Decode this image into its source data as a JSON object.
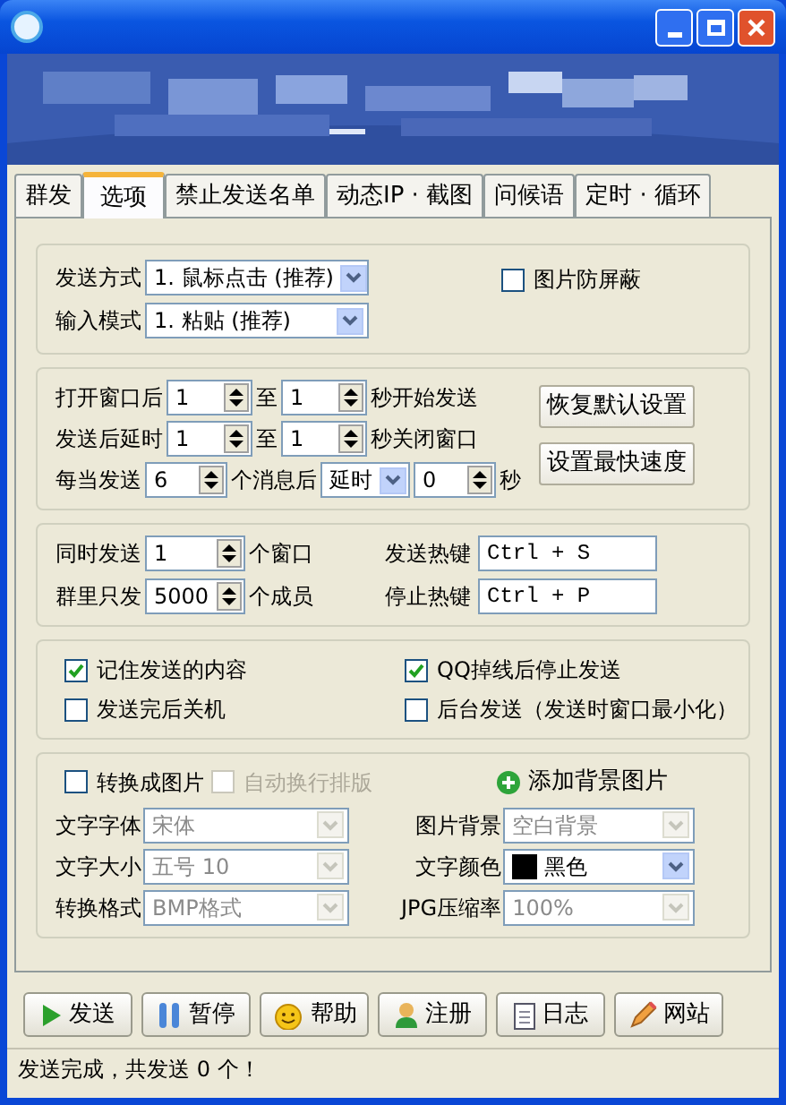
{
  "tabs": [
    {
      "label": "群发",
      "selected": false
    },
    {
      "label": "选项",
      "selected": true
    },
    {
      "label": "禁止发送名单",
      "selected": false
    },
    {
      "label": "动态IP · 截图",
      "selected": false
    },
    {
      "label": "问候语",
      "selected": false
    },
    {
      "label": "定时 · 循环",
      "selected": false
    }
  ],
  "mode_group": {
    "selects": [
      {
        "label": "发送方式",
        "value": "1. 鼠标点击 (推荐)"
      },
      {
        "label": "输入模式",
        "value": "1. 粘贴 (推荐)"
      }
    ],
    "checkbox": {
      "label": "图片防屏蔽",
      "checked": false
    }
  },
  "timing_group": {
    "rows": [
      {
        "label": "打开窗口后",
        "from": "1",
        "sep": "至",
        "to": "1",
        "suffix": "秒开始发送"
      },
      {
        "label": "发送后延时",
        "from": "1",
        "sep": "至",
        "to": "1",
        "suffix": "秒关闭窗口"
      }
    ],
    "batch": {
      "label": "每当发送",
      "count": "6",
      "middle": "个消息后",
      "action": "延时",
      "seconds": "0",
      "suffix": "秒"
    },
    "buttons": [
      "恢复默认设置",
      "设置最快速度"
    ]
  },
  "limit_group": {
    "rows": [
      {
        "label": "同时发送",
        "value": "1",
        "suffix": "个窗口"
      },
      {
        "label": "群里只发",
        "value": "5000",
        "suffix": "个成员"
      }
    ],
    "hotkeys": [
      {
        "label": "发送热键",
        "value": "Ctrl + S"
      },
      {
        "label": "停止热键",
        "value": "Ctrl + P"
      }
    ]
  },
  "options": [
    {
      "label": "记住发送的内容",
      "checked": true
    },
    {
      "label": "QQ掉线后停止发送",
      "checked": true
    },
    {
      "label": "发送完后关机",
      "checked": false
    },
    {
      "label": "后台发送（发送时窗口最小化）",
      "checked": false
    }
  ],
  "image_group": {
    "convert": {
      "label": "转换成图片",
      "checked": false
    },
    "auto_wrap": {
      "label": "自动换行排版",
      "checked": false,
      "disabled": true
    },
    "add_background": "添加背景图片",
    "selects": [
      {
        "label": "文字字体",
        "value": "宋体",
        "disabled": true
      },
      {
        "label": "图片背景",
        "value": "空白背景",
        "disabled": true
      },
      {
        "label": "文字大小",
        "value": "五号 10",
        "disabled": true
      },
      {
        "label": "文字颜色",
        "value": "黑色",
        "disabled": false,
        "color": "#000000"
      },
      {
        "label": "转换格式",
        "value": "BMP格式",
        "disabled": true
      },
      {
        "label": "JPG压缩率",
        "value": "100%",
        "disabled": true
      }
    ]
  },
  "actions": [
    {
      "label": "发送",
      "kind": "play"
    },
    {
      "label": "暂停",
      "kind": "pause"
    },
    {
      "label": "帮助",
      "kind": "smiley"
    },
    {
      "label": "注册",
      "kind": "user"
    },
    {
      "label": "日志",
      "kind": "notepad"
    },
    {
      "label": "网站",
      "kind": "pencil"
    }
  ],
  "status_bar": "发送完成，共发送 0 个！"
}
